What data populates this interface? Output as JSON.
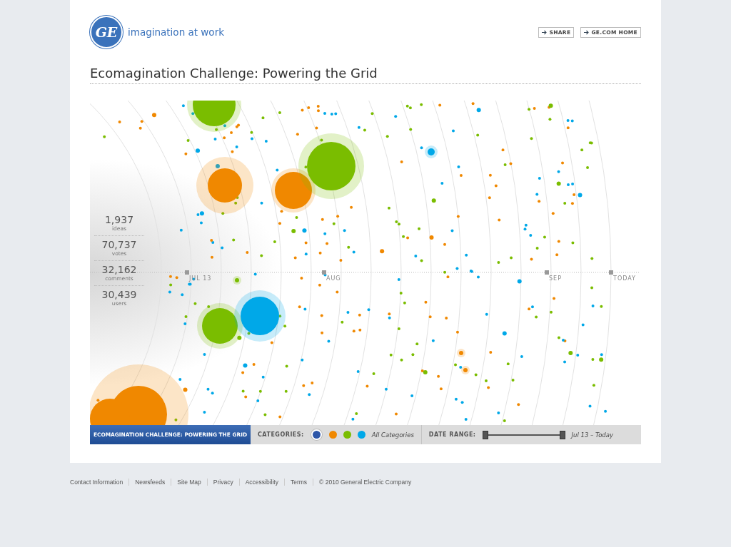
{
  "header": {
    "logo_text": "GE",
    "tagline": "imagination at work",
    "links": [
      {
        "label": "SHARE"
      },
      {
        "label": "GE.COM HOME"
      }
    ]
  },
  "title": "Ecomagination Challenge: Powering the Grid",
  "stats": [
    {
      "value": "1,937",
      "label": "ideas"
    },
    {
      "value": "70,737",
      "label": "votes"
    },
    {
      "value": "32,162",
      "label": "comments"
    },
    {
      "value": "30,439",
      "label": "users"
    }
  ],
  "timeline": [
    {
      "label": "JUL 13"
    },
    {
      "label": "AUG"
    },
    {
      "label": "SEP"
    },
    {
      "label": "TODAY"
    }
  ],
  "bar": {
    "title": "ECOMAGINATION CHALLENGE: POWERING THE GRID",
    "categories_label": "CATEGORIES:",
    "categories": [
      {
        "color": "#2d56a8",
        "selected": true
      },
      {
        "color": "#f08800",
        "selected": false
      },
      {
        "color": "#7abd00",
        "selected": false
      },
      {
        "color": "#00a8e8",
        "selected": false
      }
    ],
    "all_categories": "All Categories",
    "date_label": "DATE RANGE:",
    "date_range": {
      "level": 1
    },
    "date_value": "Jul 13 – Today"
  },
  "footer": {
    "links": [
      "Contact Information",
      "Newsfeeds",
      "Site Map",
      "Privacy",
      "Accessibility",
      "Terms"
    ],
    "copyright": "© 2010 General Electric Company"
  }
}
